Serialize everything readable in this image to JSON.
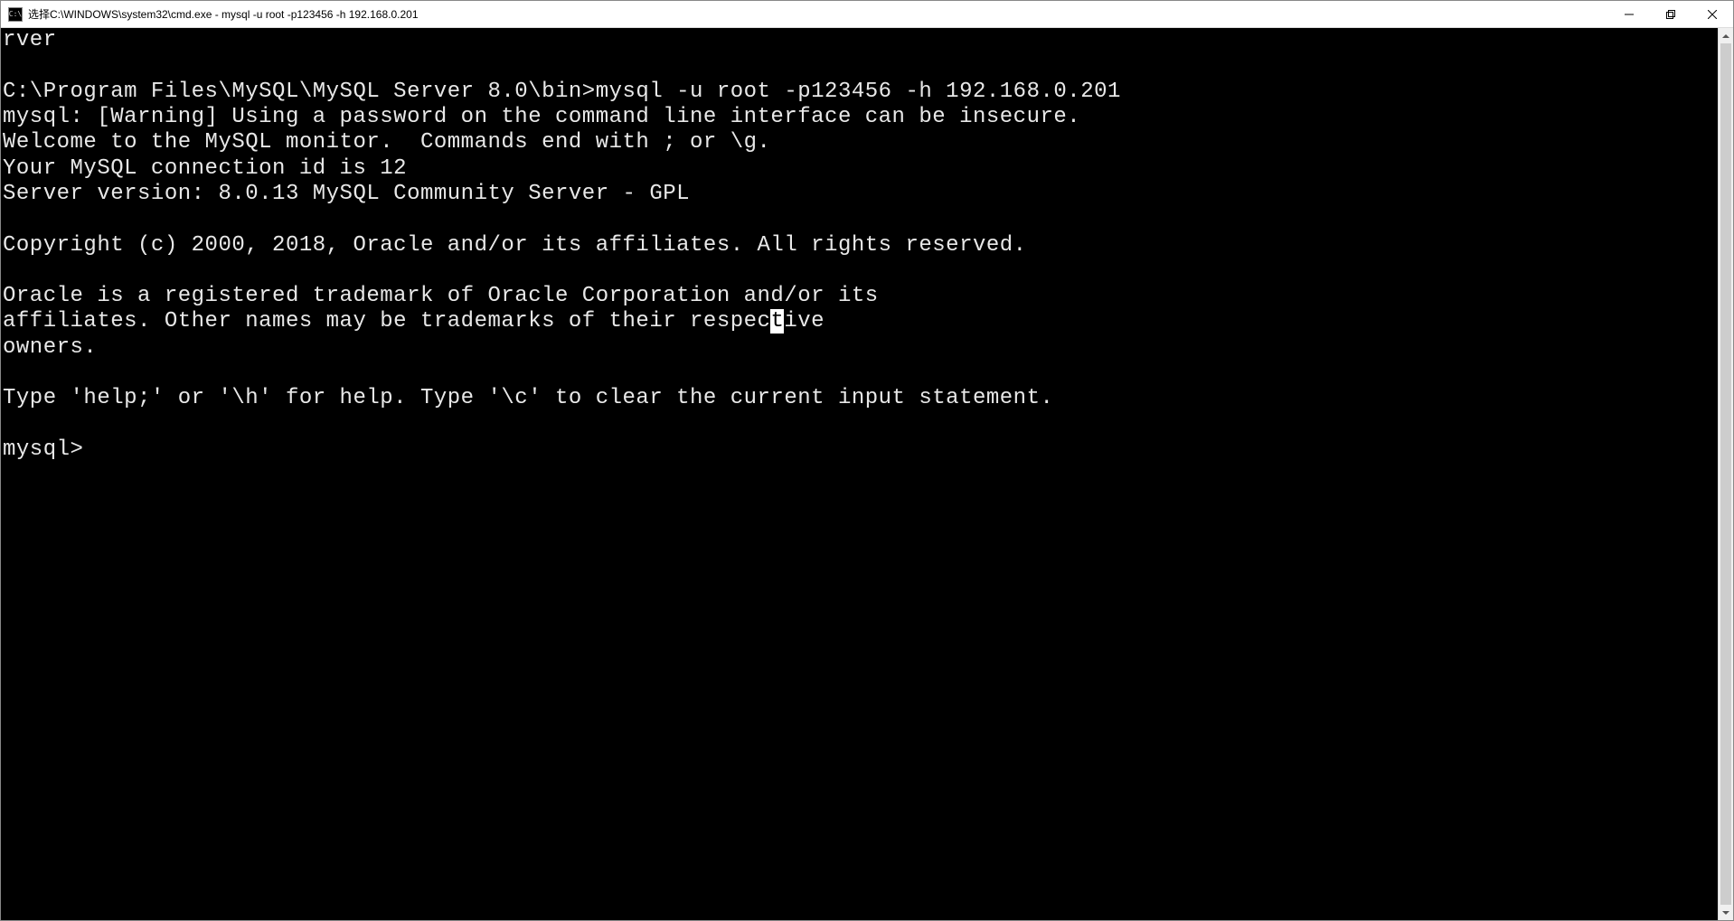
{
  "titlebar": {
    "icon_label": "C:\\",
    "title": "选择C:\\WINDOWS\\system32\\cmd.exe - mysql  -u root -p123456 -h 192.168.0.201"
  },
  "terminal": {
    "lines": [
      "rver",
      "",
      "C:\\Program Files\\MySQL\\MySQL Server 8.0\\bin>mysql -u root -p123456 -h 192.168.0.201",
      "mysql: [Warning] Using a password on the command line interface can be insecure.",
      "Welcome to the MySQL monitor.  Commands end with ; or \\g.",
      "Your MySQL connection id is 12",
      "Server version: 8.0.13 MySQL Community Server - GPL",
      "",
      "Copyright (c) 2000, 2018, Oracle and/or its affiliates. All rights reserved.",
      "",
      "Oracle is a registered trademark of Oracle Corporation and/or its"
    ],
    "split_line": {
      "pre": "affiliates. Other names may be trademarks of their respec",
      "mark": "t",
      "post": "ive"
    },
    "after_lines": [
      "owners.",
      "",
      "Type 'help;' or '\\h' for help. Type '\\c' to clear the current input statement.",
      ""
    ],
    "prompt": "mysql>"
  }
}
